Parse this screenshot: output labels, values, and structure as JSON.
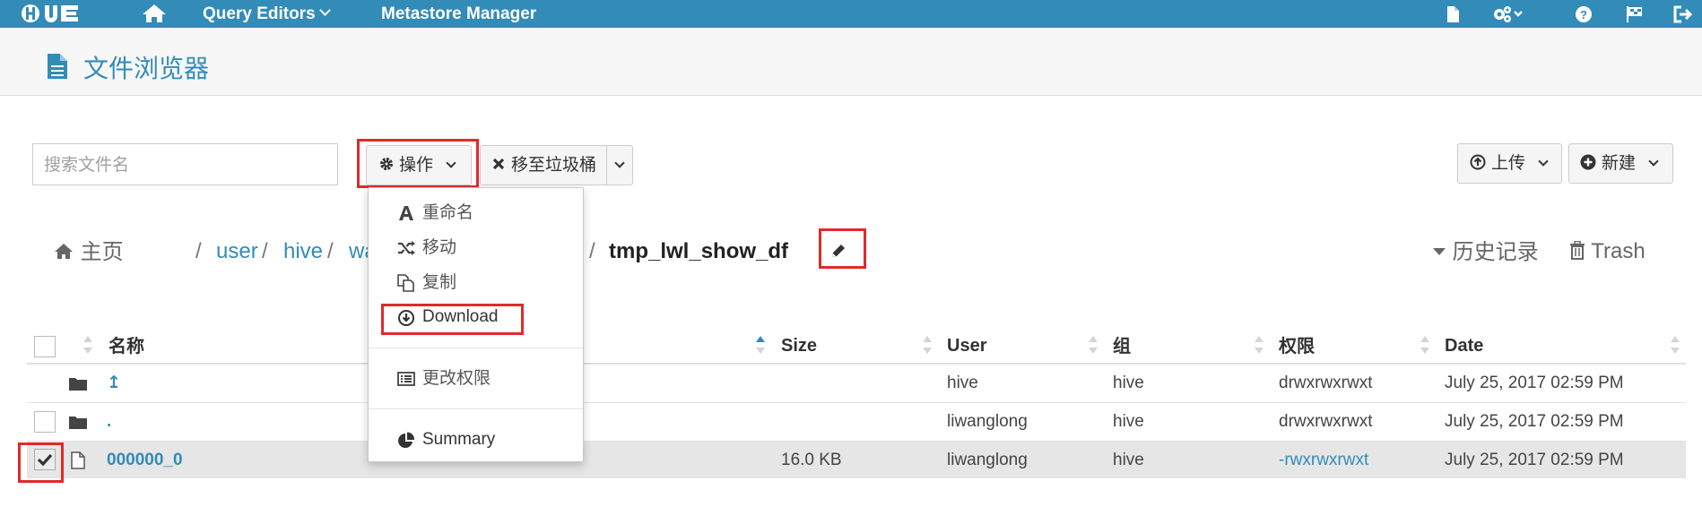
{
  "app": {
    "logo_text": "HUE",
    "colors": {
      "nav_bg": "#338bb8",
      "link": "#338bb8",
      "highlight": "#e02a2a"
    }
  },
  "nav": {
    "query_editors": "Query Editors",
    "metastore": "Metastore Manager",
    "icons": [
      "file-icon",
      "cogs-icon",
      "help-icon",
      "flag-icon",
      "logout-icon"
    ]
  },
  "page": {
    "title": "文件浏览器"
  },
  "toolbar": {
    "search_placeholder": "搜索文件名",
    "actions_label": "操作",
    "trash_label": "移至垃圾桶",
    "upload_label": "上传",
    "new_label": "新建"
  },
  "actions_menu": {
    "items": [
      {
        "label": "重命名",
        "icon": "font-icon"
      },
      {
        "label": "移动",
        "icon": "random-icon"
      },
      {
        "label": "复制",
        "icon": "copy-icon"
      },
      {
        "label": "Download",
        "icon": "download-icon"
      },
      {
        "label": "更改权限",
        "icon": "list-alt-icon"
      },
      {
        "label": "Summary",
        "icon": "pie-chart-icon"
      }
    ]
  },
  "breadcrumb": {
    "home": "主页",
    "parts": [
      "user",
      "hive",
      "wa"
    ],
    "current": "tmp_lwl_show_df",
    "history": "历史记录",
    "trash": "Trash"
  },
  "table": {
    "headers": {
      "name": "名称",
      "size": "Size",
      "user": "User",
      "group": "组",
      "perm": "权限",
      "date": "Date"
    },
    "rows": [
      {
        "name": "↥",
        "size": "",
        "user": "hive",
        "group": "hive",
        "perm": "drwxrwxrwxt",
        "date": "July 25, 2017 02:59 PM",
        "type": "folder",
        "selected": false
      },
      {
        "name": ".",
        "size": "",
        "user": "liwanglong",
        "group": "hive",
        "perm": "drwxrwxrwxt",
        "date": "July 25, 2017 02:59 PM",
        "type": "folder",
        "selected": false
      },
      {
        "name": "000000_0",
        "size": "16.0 KB",
        "user": "liwanglong",
        "group": "hive",
        "perm": "-rwxrwxrwxt",
        "date": "July 25, 2017 02:59 PM",
        "type": "file",
        "selected": true
      }
    ]
  }
}
